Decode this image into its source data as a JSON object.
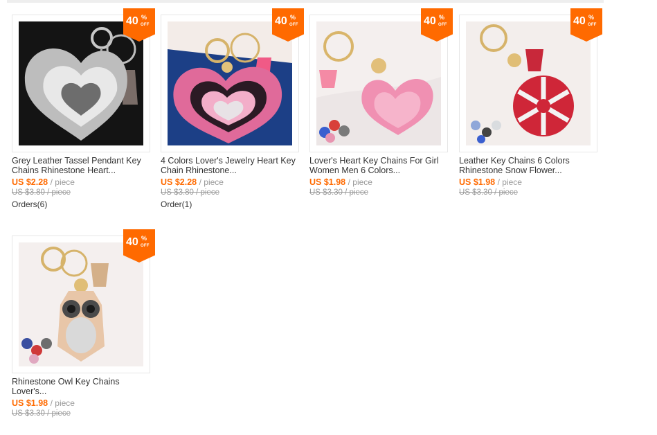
{
  "products": [
    {
      "badge": {
        "number": "40",
        "percent": "%",
        "off": "OFF"
      },
      "title_line1": "Grey Leather Tassel Pendant Key",
      "title_line2": "Chains Rhinestone Heart...",
      "price": "US $2.28",
      "unit": "/ piece",
      "original_price": "US $3.80 / piece",
      "orders": "Orders(6)",
      "icon": "grey-heart-keychain-image"
    },
    {
      "badge": {
        "number": "40",
        "percent": "%",
        "off": "OFF"
      },
      "title_line1": "4 Colors Lover's Jewelry Heart Key",
      "title_line2": "Chain Rhinestone...",
      "price": "US $2.28",
      "unit": "/ piece",
      "original_price": "US $3.80 / piece",
      "orders": "Order(1)",
      "icon": "pink-heart-keychain-image"
    },
    {
      "badge": {
        "number": "40",
        "percent": "%",
        "off": "OFF"
      },
      "title_line1": "Lover's Heart Key Chains For Girl",
      "title_line2": "Women Men 6 Colors...",
      "price": "US $1.98",
      "unit": "/ piece",
      "original_price": "US $3.30 / piece",
      "orders": "",
      "icon": "light-pink-heart-keychain-image"
    },
    {
      "badge": {
        "number": "40",
        "percent": "%",
        "off": "OFF"
      },
      "title_line1": "Leather Key Chains 6 Colors",
      "title_line2": "Rhinestone Snow Flower...",
      "price": "US $1.98",
      "unit": "/ piece",
      "original_price": "US $3.30 / piece",
      "orders": "",
      "icon": "snowflake-keychain-image"
    },
    {
      "badge": {
        "number": "40",
        "percent": "%",
        "off": "OFF"
      },
      "title_line1": "Rhinestone Owl Key Chains",
      "title_line2": "Lover's...",
      "price": "US $1.98",
      "unit": "/ piece",
      "original_price": "US $3.30 / piece",
      "orders": "",
      "icon": "owl-keychain-image"
    }
  ]
}
